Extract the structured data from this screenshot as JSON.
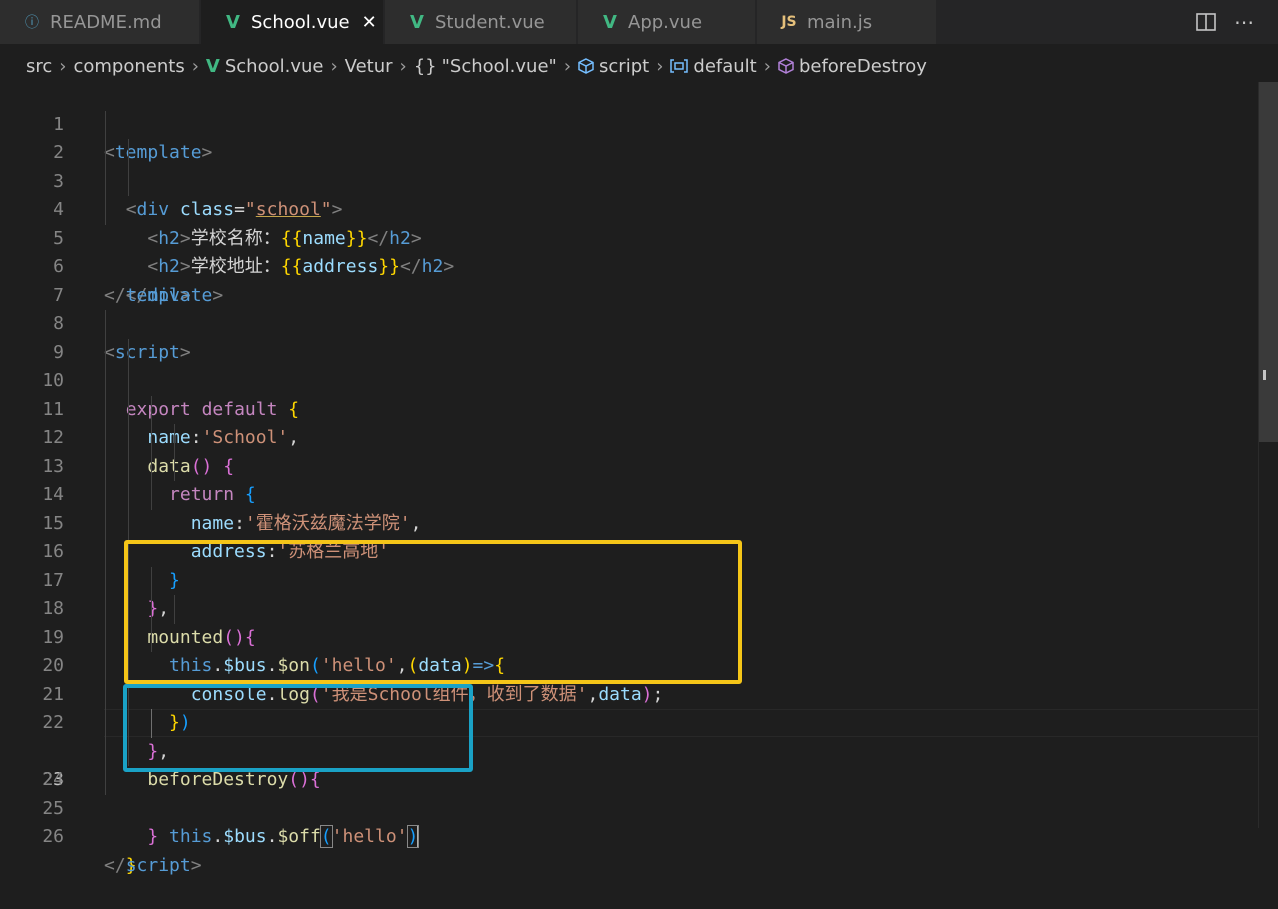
{
  "tabs": [
    {
      "label": "README.md",
      "icon": "info-icon"
    },
    {
      "label": "School.vue",
      "icon": "vue-icon",
      "active": true,
      "close": "✕"
    },
    {
      "label": "Student.vue",
      "icon": "vue-icon"
    },
    {
      "label": "App.vue",
      "icon": "vue-icon"
    },
    {
      "label": "main.js",
      "icon": "js-icon",
      "icon_text": "JS"
    }
  ],
  "breadcrumb": {
    "items": [
      "src",
      "components",
      "School.vue",
      "Vetur",
      "\"School.vue\"",
      "script",
      "default",
      "beforeDestroy"
    ],
    "curly": "{}"
  },
  "editor": {
    "current_line": 23,
    "line_numbers": [
      "1",
      "2",
      "3",
      "4",
      "5",
      "6",
      "7",
      "8",
      "9",
      "10",
      "11",
      "12",
      "13",
      "14",
      "15",
      "16",
      "17",
      "18",
      "19",
      "20",
      "21",
      "22",
      "23",
      "24",
      "25",
      "26"
    ],
    "tokens": {
      "template": "template",
      "div": "div",
      "class_attr": "class",
      "school_class": "school",
      "h2": "h2",
      "school_name_label": "学校名称：",
      "school_addr_label": "学校地址：",
      "name_var": "name",
      "address_var": "address",
      "script": "script",
      "export": "export",
      "default": "default",
      "name_key": "name",
      "school_str": "'School'",
      "data_fn": "data",
      "return_kw": "return",
      "name_key2": "name",
      "name_val": "'霍格沃兹魔法学院'",
      "address_key": "address",
      "address_val": "'苏格兰高地'",
      "mounted": "mounted",
      "this_kw": "this",
      "bus": "$bus",
      "on": "$on",
      "hello_str": "'hello'",
      "data_param": "data",
      "console": "console",
      "log": "log",
      "log_str": "'我是School组件，收到了数据'",
      "data_arg": "data",
      "before_destroy": "beforeDestroy",
      "off": "$off"
    }
  },
  "annotations": {
    "yellow_color": "#f5c518",
    "blue_color": "#1aa2c6"
  }
}
